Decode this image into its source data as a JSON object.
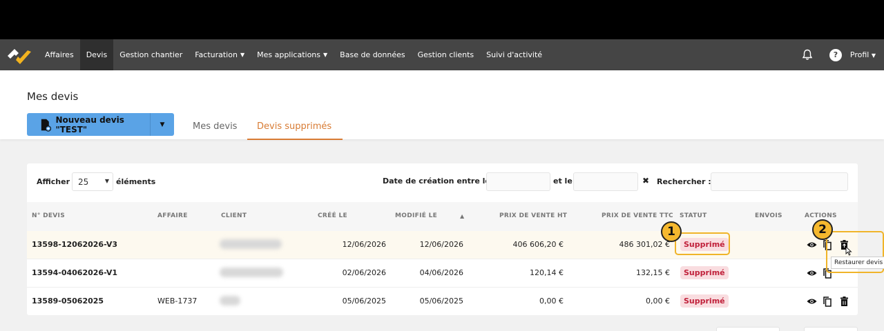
{
  "nav": {
    "items": [
      "Affaires",
      "Devis",
      "Gestion chantier",
      "Facturation",
      "Mes applications",
      "Base de données",
      "Gestion clients",
      "Suivi d'activité"
    ],
    "active_index": 1,
    "profile_label": "Profil",
    "help_label": "?"
  },
  "header": {
    "title": "Mes devis",
    "new_button_label": "Nouveau devis \"TEST\"",
    "tabs": [
      "Mes devis",
      "Devis supprimés"
    ],
    "active_tab_index": 1
  },
  "filters": {
    "show_label": "Afficher",
    "page_size": "25",
    "elements_label": "éléments",
    "date_label": "Date de création entre le",
    "and_label": "et le",
    "clear_symbol": "✖",
    "search_label": "Rechercher :"
  },
  "table": {
    "columns": [
      "N° DEVIS",
      "AFFAIRE",
      "CLIENT",
      "CRÉÉ LE",
      "MODIFIÉ LE",
      "PRIX DE VENTE HT",
      "PRIX DE VENTE TTC",
      "STATUT",
      "ENVOIS",
      "ACTIONS"
    ],
    "rows": [
      {
        "num": "13598-12062026-V3",
        "affaire": "",
        "cree": "12/06/2026",
        "modifie": "12/06/2026",
        "ht": "406 606,20 €",
        "ttc": "486 301,02 €",
        "statut": "Supprimé"
      },
      {
        "num": "13594-04062026-V1",
        "affaire": "",
        "cree": "02/06/2026",
        "modifie": "04/06/2026",
        "ht": "120,14 €",
        "ttc": "132,15 €",
        "statut": "Supprimé"
      },
      {
        "num": "13589-05062025",
        "affaire": "WEB-1737",
        "cree": "05/06/2025",
        "modifie": "05/06/2025",
        "ht": "0,00 €",
        "ttc": "0,00 €",
        "statut": "Supprimé"
      }
    ]
  },
  "annotations": {
    "one": "1",
    "two": "2"
  },
  "tooltip": "Restaurer devis",
  "colors": {
    "accent": "#d87b33",
    "primary_button": "#5aa3e6",
    "nav_bg": "#454545",
    "badge_bg": "#f9dde0",
    "badge_text": "#c0203a",
    "annotation": "#f0b429"
  },
  "icons": [
    "logo-icon",
    "file-icon",
    "bell-icon",
    "help-icon",
    "eye-icon",
    "copy-icon",
    "restore-trash-icon"
  ]
}
